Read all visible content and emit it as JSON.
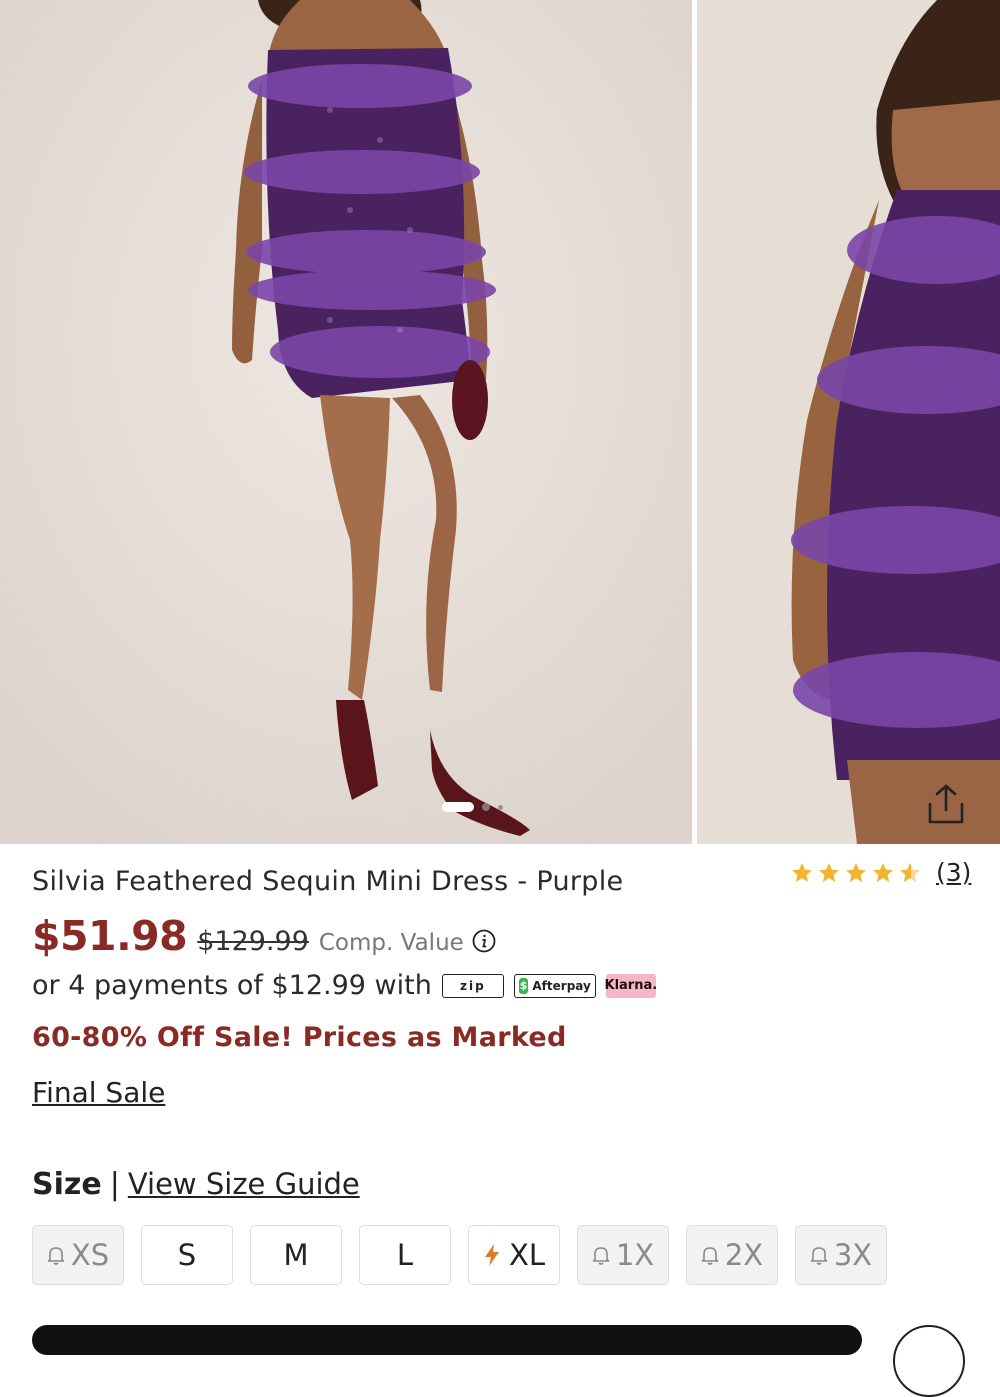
{
  "product": {
    "title": "Silvia Feathered Sequin Mini Dress - Purple",
    "rating_stars": 4.5,
    "rating_count": "(3)",
    "sale_price": "$51.98",
    "original_price": "$129.99",
    "comp_value_label": "Comp. Value",
    "installments_text": "or 4 payments of $12.99 with",
    "payment_providers": [
      "zip",
      "Afterpay",
      "Klarna."
    ],
    "sale_banner": "60-80% Off Sale! Prices as Marked",
    "final_sale_link": "Final Sale"
  },
  "gallery": {
    "image_count": 3,
    "active_index": 0,
    "share_icon": "share-icon"
  },
  "size_section": {
    "label": "Size",
    "separator": "|",
    "guide_link": "View Size Guide",
    "sizes": [
      {
        "label": "XS",
        "status": "notify",
        "icon": "bell-icon"
      },
      {
        "label": "S",
        "status": "available"
      },
      {
        "label": "M",
        "status": "available"
      },
      {
        "label": "L",
        "status": "available"
      },
      {
        "label": "XL",
        "status": "low-stock",
        "icon": "bolt-icon"
      },
      {
        "label": "1X",
        "status": "notify",
        "icon": "bell-icon"
      },
      {
        "label": "2X",
        "status": "notify",
        "icon": "bell-icon"
      },
      {
        "label": "3X",
        "status": "notify",
        "icon": "bell-icon"
      }
    ]
  },
  "colors": {
    "price_red": "#8a2a24",
    "star_gold": "#f2b531",
    "dress_purple": "#5b2a78",
    "bolt_orange": "#e0792e"
  }
}
